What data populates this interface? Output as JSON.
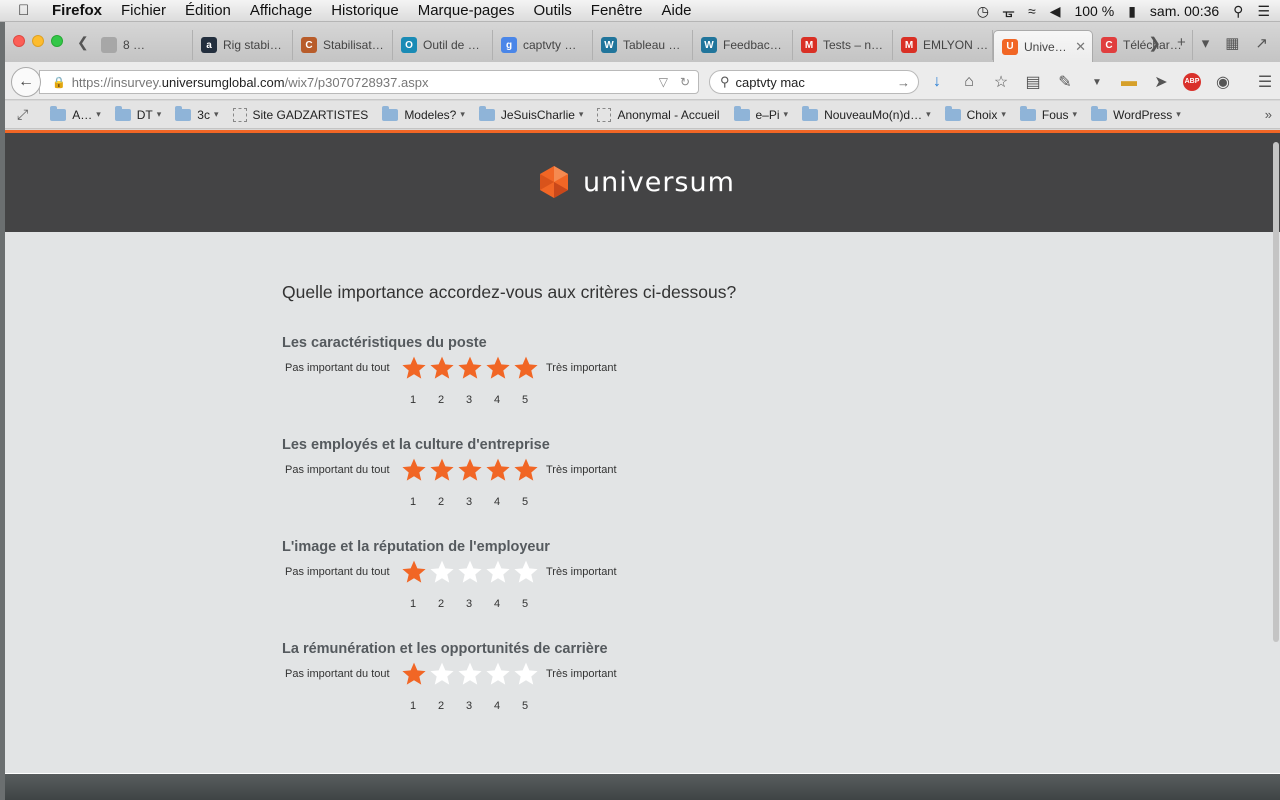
{
  "menubar": {
    "items": [
      "Firefox",
      "Fichier",
      "Édition",
      "Affichage",
      "Historique",
      "Marque-pages",
      "Outils",
      "Fenêtre",
      "Aide"
    ],
    "battery": "100 %",
    "clock": "sam. 00:36"
  },
  "tabs": [
    {
      "label": "8 …",
      "fav_color": "#a7a7a7",
      "fav_glyph": ""
    },
    {
      "label": "Rig stabi…",
      "fav_color": "#232f3e",
      "fav_glyph": "a"
    },
    {
      "label": "Stabilisat…",
      "fav_color": "#b85c2a",
      "fav_glyph": "C"
    },
    {
      "label": "Outil de …",
      "fav_color": "#1a8bb5",
      "fav_glyph": "O"
    },
    {
      "label": "captvty …",
      "fav_color": "#4a86e8",
      "fav_glyph": "g"
    },
    {
      "label": "Tableau …",
      "fav_color": "#21759b",
      "fav_glyph": "W"
    },
    {
      "label": "Feedbac…",
      "fav_color": "#21759b",
      "fav_glyph": "W"
    },
    {
      "label": "Tests – n…",
      "fav_color": "#d93025",
      "fav_glyph": "M"
    },
    {
      "label": "EMLYON …",
      "fav_color": "#d93025",
      "fav_glyph": "M"
    },
    {
      "label": "Unive…",
      "fav_color": "#f16625",
      "fav_glyph": "U",
      "active": true
    },
    {
      "label": "Téléchar…",
      "fav_color": "#e03e3e",
      "fav_glyph": "C"
    }
  ],
  "navbar": {
    "url_prefix": "https://insurvey.",
    "url_host": "universumglobal.com",
    "url_path": "/wix7/p3070728937.aspx",
    "search_value": "captvty mac"
  },
  "bookmarks": [
    {
      "label": "A…",
      "type": "folder",
      "menu": true
    },
    {
      "label": "DT",
      "type": "folder",
      "menu": true
    },
    {
      "label": "3c",
      "type": "folder",
      "menu": true
    },
    {
      "label": "Site GADZARTISTES",
      "type": "page",
      "menu": false
    },
    {
      "label": "Modeles?",
      "type": "folder",
      "menu": true
    },
    {
      "label": "JeSuisCharlie",
      "type": "folder",
      "menu": true
    },
    {
      "label": "Anonymal - Accueil",
      "type": "page",
      "menu": false
    },
    {
      "label": "e–Pi",
      "type": "folder",
      "menu": true
    },
    {
      "label": "NouveauMo(n)d…",
      "type": "folder",
      "menu": true
    },
    {
      "label": "Choix",
      "type": "folder",
      "menu": true
    },
    {
      "label": "Fous",
      "type": "folder",
      "menu": true
    },
    {
      "label": "WordPress",
      "type": "folder",
      "menu": true
    }
  ],
  "page": {
    "brand": "universum",
    "accent_color": "#f16625",
    "question": "Quelle importance accordez-vous aux critères ci-dessous?",
    "scale_low": "Pas important du tout",
    "scale_high": "Très important",
    "scale_numbers": [
      "1",
      "2",
      "3",
      "4",
      "5"
    ],
    "criteria": [
      {
        "title": "Les caractéristiques du poste",
        "rating": 5
      },
      {
        "title": "Les employés et la culture d'entreprise",
        "rating": 5
      },
      {
        "title": "L'image et la réputation de l'employeur",
        "rating": 1
      },
      {
        "title": "La rémunération et les opportunités de carrière",
        "rating": 1
      }
    ]
  }
}
